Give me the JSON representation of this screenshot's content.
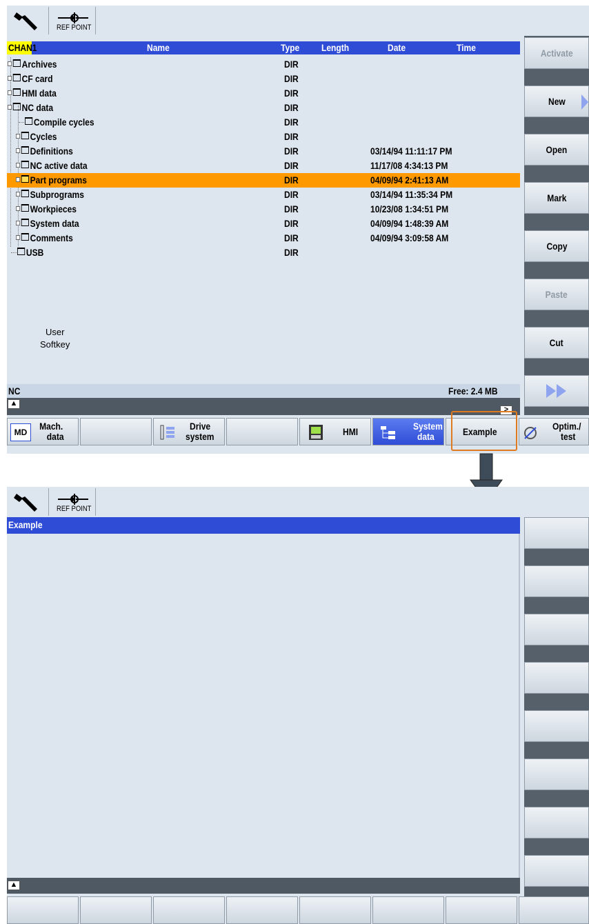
{
  "top_screen": {
    "ref_point_label": "REF POINT",
    "channel": "CHAN1",
    "columns": {
      "name": "Name",
      "type": "Type",
      "length": "Length",
      "date": "Date",
      "time": "Time"
    },
    "rows": [
      {
        "name": "Archives",
        "type": "DIR",
        "date": ""
      },
      {
        "name": "CF card",
        "type": "DIR",
        "date": ""
      },
      {
        "name": "HMI data",
        "type": "DIR",
        "date": ""
      },
      {
        "name": "NC data",
        "type": "DIR",
        "date": ""
      },
      {
        "name": "Compile cycles",
        "type": "DIR",
        "date": ""
      },
      {
        "name": "Cycles",
        "type": "DIR",
        "date": ""
      },
      {
        "name": "Definitions",
        "type": "DIR",
        "date": "03/14/94 11:11:17 PM"
      },
      {
        "name": "NC active data",
        "type": "DIR",
        "date": "11/17/08 4:34:13 PM"
      },
      {
        "name": "Part programs",
        "type": "DIR",
        "date": "04/09/94 2:41:13 AM"
      },
      {
        "name": "Subprograms",
        "type": "DIR",
        "date": "03/14/94 11:35:34 PM"
      },
      {
        "name": "Workpieces",
        "type": "DIR",
        "date": "10/23/08 1:34:51 PM"
      },
      {
        "name": "System data",
        "type": "DIR",
        "date": "04/09/94 1:48:39 AM"
      },
      {
        "name": "Comments",
        "type": "DIR",
        "date": "04/09/94 3:09:58 AM"
      },
      {
        "name": "USB",
        "type": "DIR",
        "date": ""
      }
    ],
    "user_softkey_line1": "User",
    "user_softkey_line2": "Softkey",
    "status_left": "NC",
    "status_right": "Free: 2.4 MB",
    "vertical_softkeys": [
      "Activate",
      "New",
      "Open",
      "Mark",
      "Copy",
      "Paste",
      "Cut",
      ""
    ],
    "horizontal_softkeys": [
      {
        "line1": "Mach.",
        "line2": "data",
        "icon": "md-icon"
      },
      {
        "line1": "",
        "line2": "",
        "icon": ""
      },
      {
        "line1": "Drive",
        "line2": "system",
        "icon": "drive-system-icon"
      },
      {
        "line1": "",
        "line2": "",
        "icon": ""
      },
      {
        "line1": "HMI",
        "line2": "",
        "icon": "hmi-icon"
      },
      {
        "line1": "System",
        "line2": "data",
        "icon": "system-data-icon"
      },
      {
        "line1": "Example",
        "line2": "",
        "icon": ""
      },
      {
        "line1": "Optim./",
        "line2": "test",
        "icon": "optim-icon"
      }
    ],
    "md_icon_text": "MD"
  },
  "bottom_screen": {
    "ref_point_label": "REF POINT",
    "title": "Example"
  },
  "colors": {
    "screen_bg": "#dde5ee",
    "header_blue": "#2f4cd6",
    "selection_orange": "#ff9900",
    "channel_yellow": "#ffff00",
    "highlight_border": "#e07a1f",
    "arrow": "#3e4c59"
  }
}
